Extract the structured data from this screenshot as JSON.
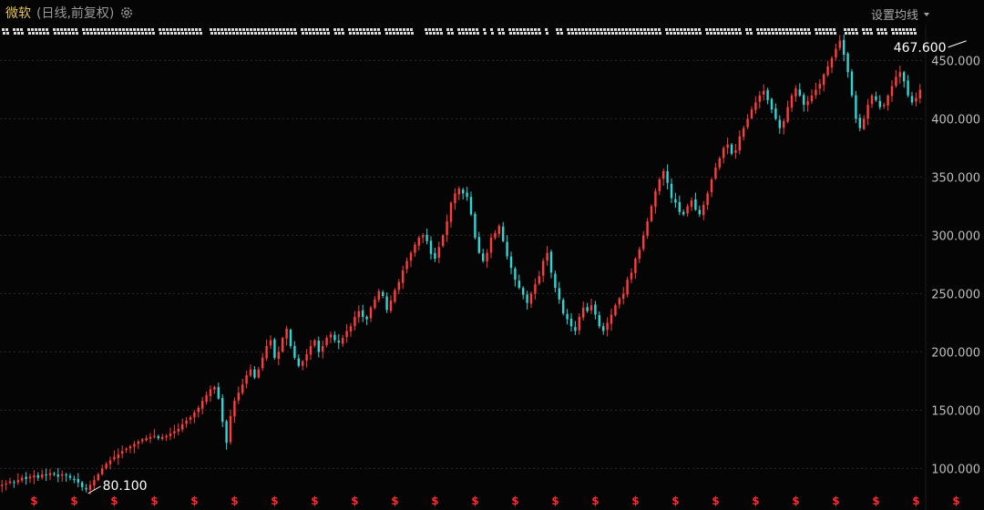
{
  "header": {
    "stock_name": "微软",
    "mode": "(日线,前复权)",
    "ma_setting_label": "设置均线"
  },
  "icons": {
    "settings": "gear-icon",
    "dropdown": "caret-down-icon"
  },
  "colors": {
    "background": "#050505",
    "up": "#ff3b3b",
    "down": "#2fd4d4",
    "grid": "#2a2a2a",
    "dividend_marker": "#ff2b2b",
    "title": "#e6c35c"
  },
  "chart_data": {
    "type": "candlestick",
    "title": "",
    "xlabel": "",
    "ylabel": "",
    "ylim": [
      80,
      480
    ],
    "y_ticks": [
      100,
      150,
      200,
      250,
      300,
      350,
      400,
      450
    ],
    "y_tick_labels": [
      "100.000",
      "150.000",
      "200.000",
      "250.000",
      "300.000",
      "350.000",
      "400.000",
      "450.000"
    ],
    "grid": true,
    "annotations": [
      {
        "label": "467.600",
        "index": 241,
        "value": 467.6
      },
      {
        "label": "80.100",
        "index": 21,
        "value": 80.1
      }
    ],
    "dividend_marker_label": "$",
    "dividend_indices": [
      8,
      18,
      28,
      38,
      48,
      58,
      68,
      78,
      88,
      98,
      108,
      118,
      128,
      138,
      148,
      158,
      168,
      178,
      188,
      198,
      208,
      218,
      228,
      238,
      248
    ],
    "closes": [
      86,
      87,
      89,
      88,
      90,
      92,
      91,
      93,
      94,
      92,
      95,
      94,
      96,
      95,
      93,
      95,
      94,
      92,
      90,
      88,
      84,
      82,
      86,
      90,
      95,
      100,
      104,
      107,
      110,
      112,
      115,
      117,
      119,
      121,
      123,
      125,
      126,
      127,
      128,
      126,
      127,
      128,
      130,
      132,
      134,
      138,
      141,
      144,
      148,
      152,
      158,
      163,
      168,
      170,
      160,
      140,
      122,
      145,
      158,
      165,
      172,
      180,
      185,
      178,
      185,
      195,
      205,
      210,
      195,
      200,
      212,
      220,
      205,
      195,
      188,
      192,
      198,
      205,
      210,
      200,
      205,
      212,
      215,
      210,
      208,
      212,
      218,
      222,
      230,
      235,
      230,
      228,
      238,
      245,
      252,
      248,
      236,
      244,
      253,
      260,
      270,
      278,
      285,
      292,
      298,
      300,
      295,
      284,
      280,
      290,
      300,
      312,
      328,
      336,
      340,
      336,
      333,
      318,
      298,
      285,
      278,
      285,
      298,
      302,
      308,
      295,
      282,
      272,
      262,
      255,
      249,
      242,
      250,
      258,
      265,
      278,
      285,
      268,
      255,
      245,
      233,
      228,
      222,
      218,
      230,
      238,
      235,
      240,
      232,
      222,
      218,
      225,
      232,
      240,
      246,
      250,
      262,
      268,
      280,
      288,
      300,
      312,
      325,
      338,
      348,
      355,
      345,
      332,
      328,
      320,
      318,
      325,
      330,
      322,
      318,
      326,
      336,
      348,
      358,
      366,
      375,
      378,
      370,
      373,
      385,
      392,
      400,
      408,
      414,
      420,
      424,
      416,
      408,
      400,
      392,
      398,
      410,
      420,
      426,
      420,
      412,
      415,
      420,
      425,
      430,
      438,
      445,
      452,
      460,
      467,
      455,
      440,
      420,
      400,
      392,
      400,
      412,
      420,
      416,
      410,
      412,
      420,
      428,
      436,
      440,
      432,
      420,
      414,
      418,
      425
    ]
  }
}
